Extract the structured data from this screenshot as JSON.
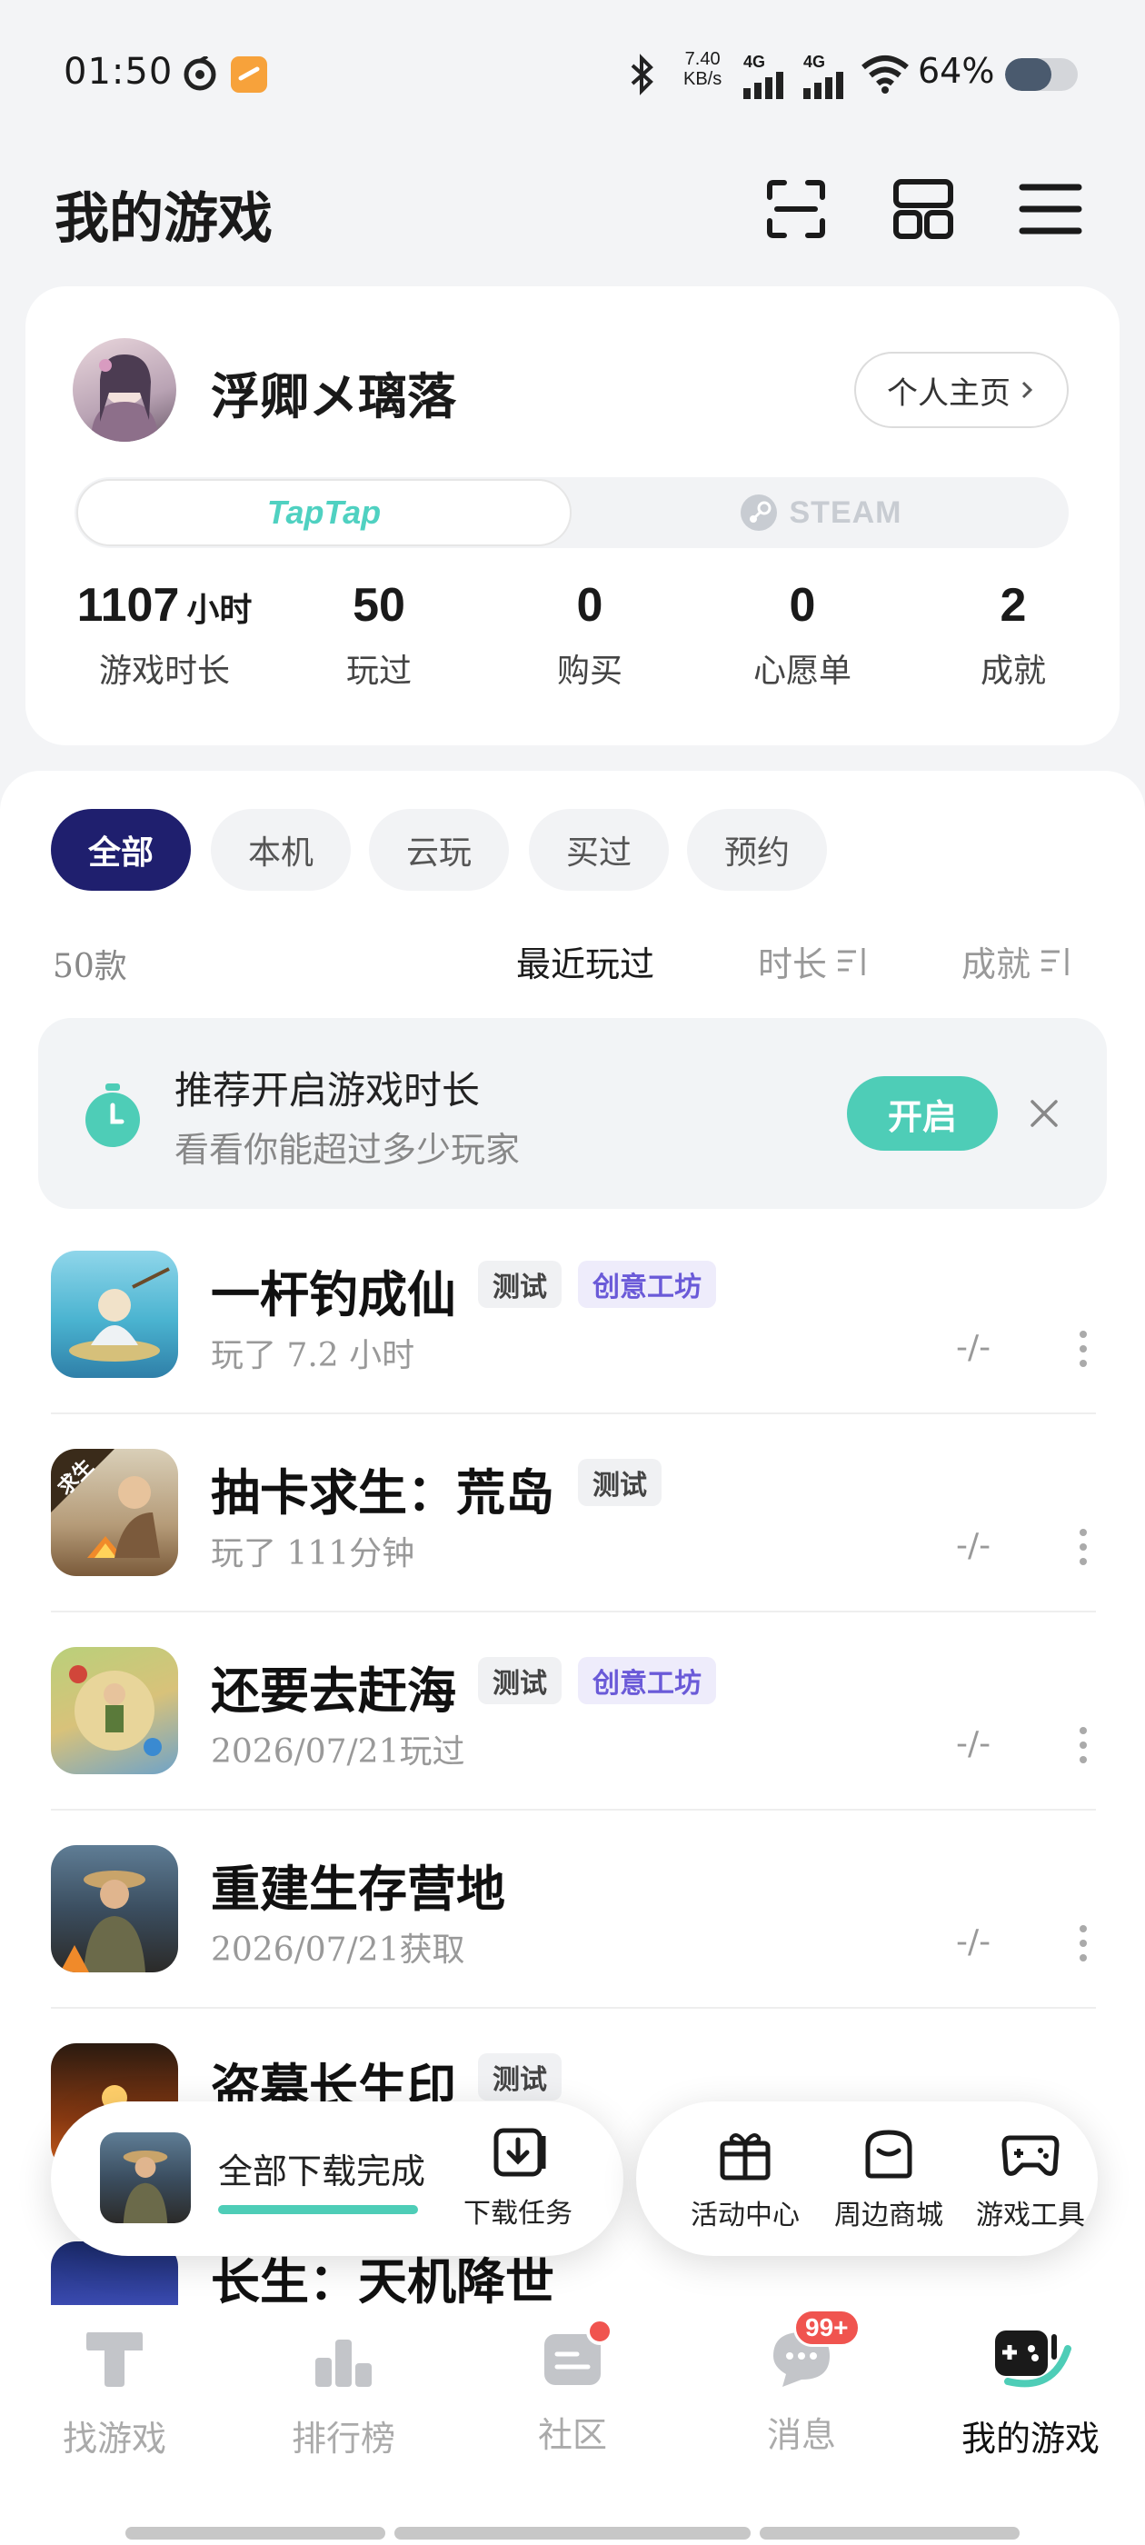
{
  "status_bar": {
    "time": "01:50",
    "net_speed_value": "7.40",
    "net_speed_unit": "KB/s",
    "signal1": "4G",
    "signal2": "4G",
    "battery": "64%"
  },
  "header": {
    "title": "我的游戏",
    "icons": [
      "scan-icon",
      "grid-icon",
      "menu-icon"
    ]
  },
  "profile": {
    "username": "浮卿メ璃落",
    "homepage_label": "个人主页",
    "platforms": [
      "TapTap",
      "STEAM"
    ],
    "selected_platform": "TapTap",
    "stats": [
      {
        "value": "1107",
        "unit": "小时",
        "label": "游戏时长"
      },
      {
        "value": "50",
        "unit": "",
        "label": "玩过"
      },
      {
        "value": "0",
        "unit": "",
        "label": "购买"
      },
      {
        "value": "0",
        "unit": "",
        "label": "心愿单"
      },
      {
        "value": "2",
        "unit": "",
        "label": "成就"
      }
    ]
  },
  "filters": {
    "chips": [
      "全部",
      "本机",
      "云玩",
      "买过",
      "预约"
    ],
    "active": "全部"
  },
  "list_header": {
    "count": "50款",
    "sorts": [
      "最近玩过",
      "时长",
      "成就"
    ],
    "active_sort": "最近玩过"
  },
  "banner": {
    "title": "推荐开启游戏时长",
    "subtitle": "看看你能超过多少玩家",
    "button": "开启"
  },
  "games": [
    {
      "name": "一杆钓成仙",
      "tags": [
        "测试",
        "创意工坊"
      ],
      "meta": "玩了 7.2 小时",
      "achievement": "-/-"
    },
    {
      "name": "抽卡求生：荒岛",
      "tags": [
        "测试"
      ],
      "meta": "玩了 111分钟",
      "achievement": "-/-",
      "corner": "求生"
    },
    {
      "name": "还要去赶海",
      "tags": [
        "测试",
        "创意工坊"
      ],
      "meta": "2026/07/21玩过",
      "achievement": "-/-"
    },
    {
      "name": "重建生存营地",
      "tags": [],
      "meta": "2026/07/21获取",
      "achievement": "-/-"
    },
    {
      "name": "盗墓长生印",
      "tags": [
        "测试"
      ],
      "meta": "",
      "achievement": ""
    },
    {
      "name": "长生：天机降世",
      "tags": [],
      "meta": "",
      "achievement": ""
    }
  ],
  "download": {
    "status": "全部下载完成",
    "task_label": "下载任务",
    "progress": 1.0
  },
  "tools": [
    "活动中心",
    "周边商城",
    "游戏工具"
  ],
  "bottom_nav": {
    "items": [
      "找游戏",
      "排行榜",
      "社区",
      "消息",
      "我的游戏"
    ],
    "active": "我的游戏",
    "message_badge": "99+"
  },
  "colors": {
    "accent": "#4ecdb7",
    "chip_active": "#1f1f6e",
    "workshop_tag": "#6a5ad8",
    "badge": "#f0544f"
  }
}
